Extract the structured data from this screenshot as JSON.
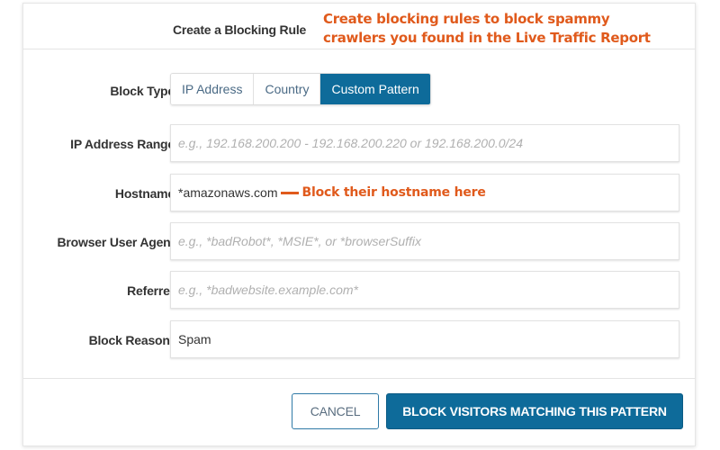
{
  "header": {
    "title": "Create a Blocking Rule",
    "annotation": "Create blocking rules to block spammy crawlers you found in the Live Traffic Report"
  },
  "block_type": {
    "label": "Block Type",
    "options": [
      {
        "label": "IP Address",
        "active": false
      },
      {
        "label": "Country",
        "active": false
      },
      {
        "label": "Custom Pattern",
        "active": true
      }
    ]
  },
  "fields": {
    "ip_range": {
      "label": "IP Address Range",
      "value": "",
      "placeholder": "e.g., 192.168.200.200 - 192.168.200.220 or 192.168.200.0/24"
    },
    "hostname": {
      "label": "Hostname",
      "value": "*amazonaws.com",
      "annotation": "Block their hostname here"
    },
    "user_agent": {
      "label": "Browser User Agent",
      "value": "",
      "placeholder": "e.g., *badRobot*, *MSIE*, or *browserSuffix"
    },
    "referrer": {
      "label": "Referrer",
      "value": "",
      "placeholder": "e.g., *badwebsite.example.com*"
    },
    "block_reason": {
      "label": "Block Reason",
      "required_marker": "*",
      "value": "Spam"
    }
  },
  "footer": {
    "cancel_label": "CANCEL",
    "submit_label": "BLOCK VISITORS MATCHING THIS PATTERN"
  },
  "colors": {
    "primary": "#0e6b9a",
    "annotation": "#e05a1c"
  }
}
